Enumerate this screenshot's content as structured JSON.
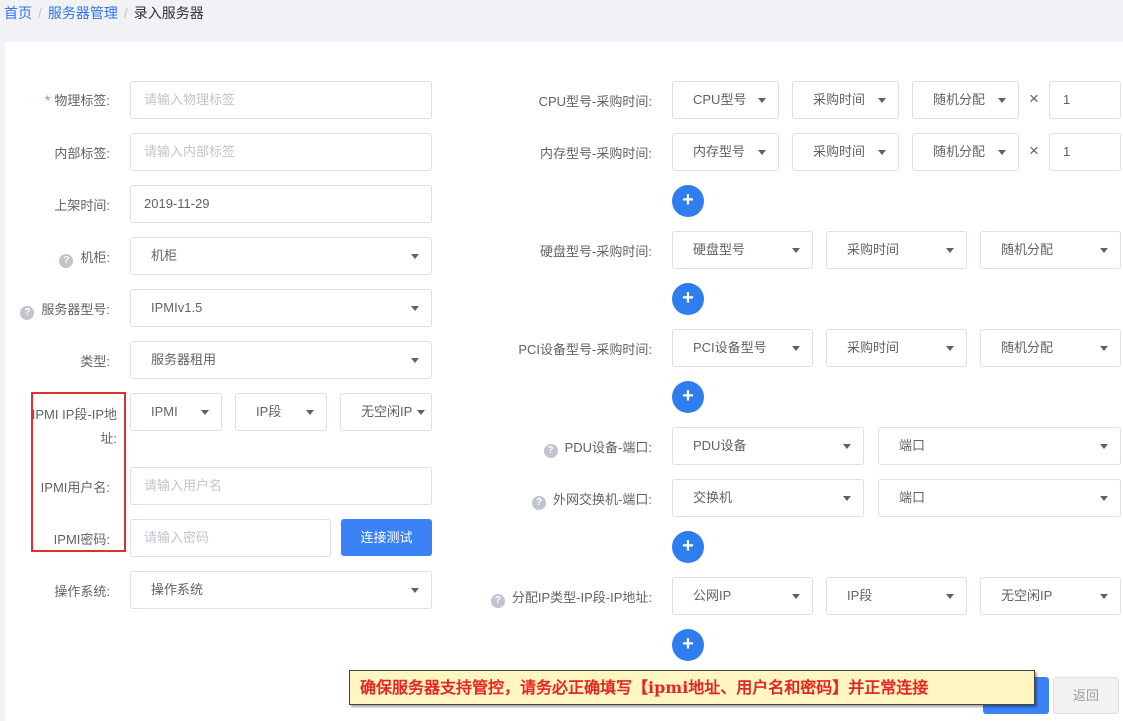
{
  "breadcrumb": {
    "home": "首页",
    "parent": "服务器管理",
    "current": "录入服务器",
    "separator": "/"
  },
  "left_form": {
    "required_mark": "*",
    "physical_tag": {
      "label": "物理标签:",
      "placeholder": "请输入物理标签"
    },
    "internal_tag": {
      "label": "内部标签:",
      "placeholder": "请输入内部标签"
    },
    "shelf_time": {
      "label": "上架时间:",
      "value": "2019-11-29"
    },
    "cabinet": {
      "label": "机柜:",
      "value": "机柜"
    },
    "server_model": {
      "label": "服务器型号:",
      "value": "IPMIv1.5"
    },
    "type": {
      "label": "类型:",
      "value": "服务器租用"
    },
    "ipmi_ip": {
      "label_line1": "IPMI IP段-IP地",
      "label_line2": "址:",
      "ipmi": "IPMI",
      "segment": "IP段",
      "address": "无空闲IP"
    },
    "ipmi_user": {
      "label": "IPMI用户名:",
      "placeholder": "请输入用户名"
    },
    "ipmi_password": {
      "label": "IPMI密码:",
      "placeholder": "请输入密码",
      "test_button": "连接测试"
    },
    "os": {
      "label": "操作系统:",
      "value": "操作系统"
    }
  },
  "right_form": {
    "cpu": {
      "label": "CPU型号-采购时间:",
      "model": "CPU型号",
      "time": "采购时间",
      "alloc": "随机分配",
      "times": "×",
      "qty": "1"
    },
    "memory": {
      "label": "内存型号-采购时间:",
      "model": "内存型号",
      "time": "采购时间",
      "alloc": "随机分配",
      "times": "×",
      "qty": "1"
    },
    "disk": {
      "label": "硬盘型号-采购时间:",
      "model": "硬盘型号",
      "time": "采购时间",
      "alloc": "随机分配"
    },
    "pci": {
      "label": "PCI设备型号-采购时间:",
      "model": "PCI设备型号",
      "time": "采购时间",
      "alloc": "随机分配"
    },
    "pdu": {
      "label": "PDU设备-端口:",
      "device": "PDU设备",
      "port": "端口"
    },
    "switch": {
      "label": "外网交换机-端口:",
      "device": "交换机",
      "port": "端口"
    },
    "ip_alloc": {
      "label": "分配IP类型-IP段-IP地址:",
      "type": "公网IP",
      "segment": "IP段",
      "address": "无空闲IP"
    },
    "plus": "+"
  },
  "help_glyph": "?",
  "actions": {
    "back": "返回"
  },
  "annotation": {
    "banner": "确保服务器支持管控，请务必正确填写【ipmi地址、用户名和密码】并正常连接",
    "banner_bg": "#fff6c2",
    "banner_color": "#e6261f",
    "highlight_color": "#e0302a"
  },
  "colors": {
    "primary": "#3b82f6",
    "link": "#2f74e8",
    "required": "#f56c6c"
  }
}
